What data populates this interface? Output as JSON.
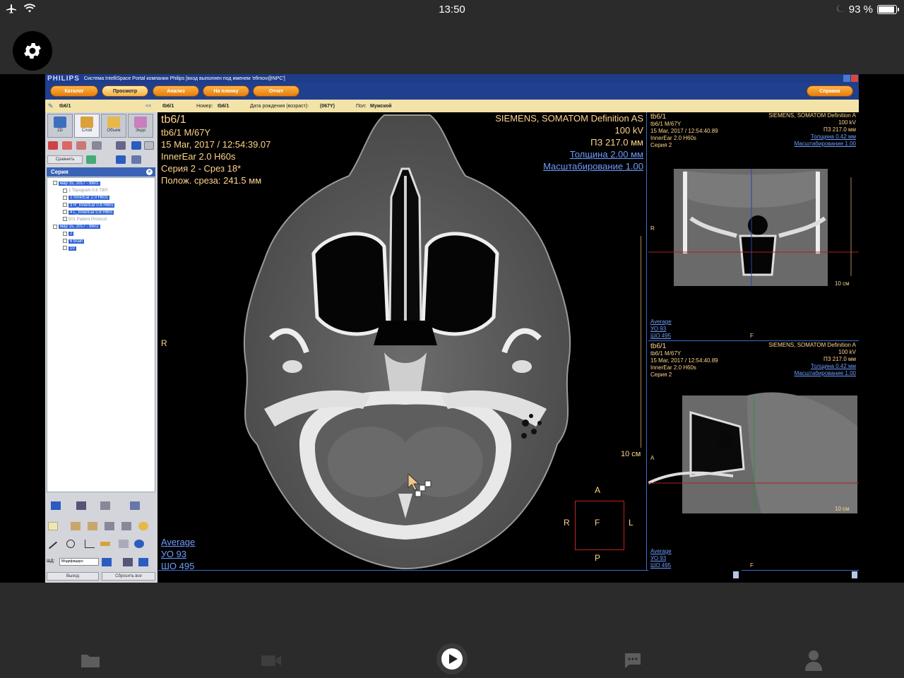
{
  "status": {
    "time": "13:50",
    "battery": "93 %",
    "battery_level": 0.93
  },
  "app": {
    "logo": "PHILIPS",
    "window_title": "Система IntelliSpace Portal компании Philips [вход выполнен под именем 'efimov@NPC']",
    "menu": [
      "Каталог",
      "Просмотр",
      "Анализ",
      "На пленку",
      "Отчет"
    ],
    "help": "Справка",
    "info": {
      "tab": "tb6/1",
      "collapse": "<<",
      "patient": "tb6/1",
      "number_label": "Номер:",
      "number": "tb6/1",
      "dob_label": "Дата рождения (возраст):",
      "dob": "(067Y)",
      "sex_label": "Пол:",
      "sex": "Мужской"
    },
    "modes": [
      {
        "label": "2D",
        "color": "#3d6fbf"
      },
      {
        "label": "Слой",
        "color": "#d9a13a"
      },
      {
        "label": "Объем",
        "color": "#e6b94a"
      },
      {
        "label": "Эндо",
        "color": "#c97fbd"
      }
    ],
    "compare_btn": "Сравнить",
    "series_header": "Серия",
    "tree": [
      {
        "text": "мар 15, 2017 - tb6/1",
        "style": "hl",
        "indent": 8
      },
      {
        "text": "1  Topogram  0.6  T80f",
        "style": "dim",
        "indent": 22
      },
      {
        "text": "2  InnerEar  2.0  H60s",
        "style": "hl",
        "indent": 22
      },
      {
        "text": "3  R_InnerEar  0.6  H60s",
        "style": "hl",
        "indent": 22
      },
      {
        "text": "4  L_InnerEar  0.6  H60s",
        "style": "hl",
        "indent": 22
      },
      {
        "text": "501  Patient Protocol",
        "style": "dim",
        "indent": 22
      },
      {
        "text": "мар 15, 2017 - tb6/2",
        "style": "hl",
        "indent": 8
      },
      {
        "text": "2",
        "style": "hl",
        "indent": 22
      },
      {
        "text": "6  brain",
        "style": "hl",
        "indent": 22
      },
      {
        "text": "10",
        "style": "hl",
        "indent": 22
      }
    ],
    "shd_label": "ШД:",
    "shd_value": "Модифициро",
    "exit_btn": "Выход",
    "reset_btn": "Сбросить все"
  },
  "main_view": {
    "tl": [
      "tb6/1",
      "tb6/1 M/67Y",
      "15 Mar, 2017 / 12:54:39.07",
      "InnerEar  2.0  H60s",
      "Серия 2 - Срез 18*",
      "Полож. среза: 241.5 мм"
    ],
    "tr": [
      "SIEMENS, SOMATOM Definition AS",
      "100 kV",
      "ПЗ 217.0 мм"
    ],
    "tr_links": [
      "Толщина 2.00 мм",
      "Масштабирование 1.00"
    ],
    "bl": [
      "Average",
      "УО    93",
      "ШО   495"
    ],
    "left_marker": "R",
    "scale": "10 см",
    "orient": {
      "top": "A",
      "left": "R",
      "center": "F",
      "right": "L",
      "bottom": "P"
    }
  },
  "coronal_view": {
    "tl": [
      "tb6/1",
      "tb6/1 M/67Y",
      "15 Mar, 2017 / 12:54:40.89",
      "InnerEar  2.0  H60s",
      "Серия 2"
    ],
    "tr": [
      "SIEMENS, SOMATOM Definition A",
      "100 kV",
      "ПЗ 217.0 мм"
    ],
    "tr_links": [
      "Толщина 0.42 мм",
      "Масштабирование 1.00"
    ],
    "bl": [
      "Average",
      "УО    93",
      "ШО   495"
    ],
    "left_marker": "R",
    "scale": "10 см",
    "bottom_marker": "F"
  },
  "sagittal_view": {
    "tl": [
      "tb6/1",
      "tb6/1 M/67Y",
      "15 Mar, 2017 / 12:54:40.89",
      "InnerEar  2.0  H60s",
      "Серия 2"
    ],
    "tr": [
      "SIEMENS, SOMATOM Definition A",
      "100 kV",
      "ПЗ 217.0 мм"
    ],
    "tr_links": [
      "Толщина 0.42 мм",
      "Масштабирование 1.00"
    ],
    "bl": [
      "Average",
      "УО    93",
      "ШО   495"
    ],
    "left_marker": "A",
    "scale": "10 см",
    "bottom_marker": "F"
  },
  "tabs": [
    "folder-icon",
    "video-camera-icon",
    "play-icon",
    "chat-icon",
    "profile-icon"
  ]
}
